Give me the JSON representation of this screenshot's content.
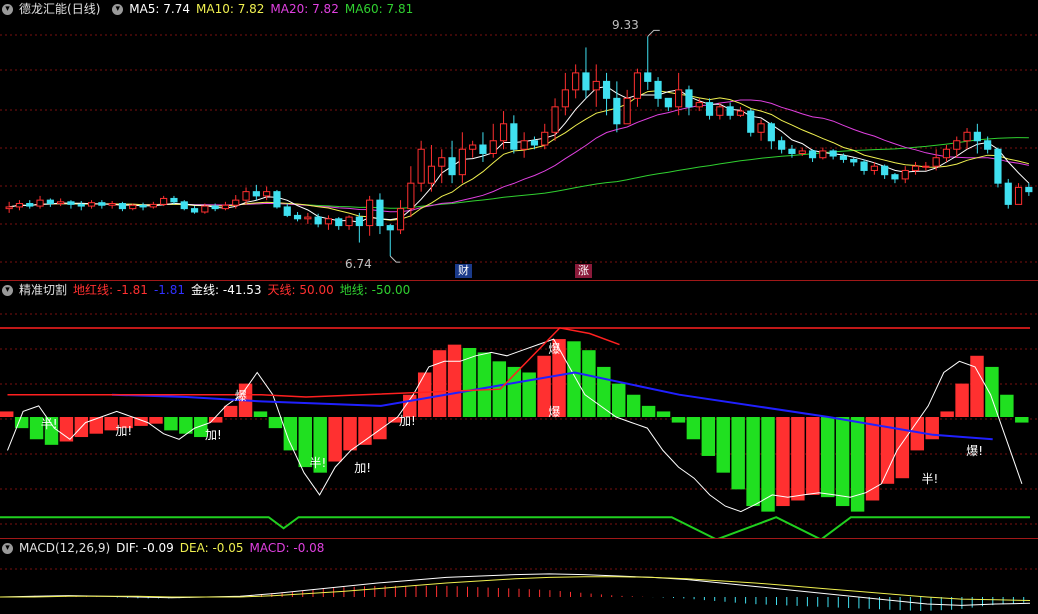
{
  "colors": {
    "ma5": "#ffffff",
    "ma10": "#f0f050",
    "ma20": "#e040e0",
    "ma60": "#30d030",
    "up": "#ff3030",
    "down": "#40e0f0",
    "grid": "#7a1010",
    "red_line": "#ff2020",
    "green_line": "#20d020",
    "blue_line": "#2020ff"
  },
  "main_pane": {
    "stock_name": "德龙汇能",
    "period": "(日线)",
    "ma5": "MA5: 7.74",
    "ma10": "MA10: 7.82",
    "ma20": "MA20: 7.82",
    "ma60": "MA60: 7.81",
    "high_label": "9.33",
    "low_label": "6.74",
    "badge_finance": "财",
    "badge_rise": "涨"
  },
  "indicator_pane": {
    "name": "精准切割",
    "dihong": "地红线: -1.81",
    "blue": "-1.81",
    "jin": "金线: -41.53",
    "tian": "天线: 50.00",
    "di": "地线: -50.00",
    "signals": [
      "半!",
      "加!",
      "加!",
      "爆",
      "半!",
      "加!",
      "加!",
      "爆",
      "爆",
      "爆!",
      "半!"
    ]
  },
  "macd_pane": {
    "name": "MACD(12,26,9)",
    "dif": "DIF: -0.09",
    "dea": "DEA: -0.05",
    "macd": "MACD: -0.08"
  },
  "series": {
    "candles": [
      [
        7.3,
        7.32,
        7.25,
        7.38
      ],
      [
        7.32,
        7.36,
        7.28,
        7.4
      ],
      [
        7.36,
        7.33,
        7.3,
        7.4
      ],
      [
        7.33,
        7.4,
        7.3,
        7.45
      ],
      [
        7.4,
        7.36,
        7.32,
        7.42
      ],
      [
        7.36,
        7.38,
        7.33,
        7.42
      ],
      [
        7.38,
        7.35,
        7.3,
        7.4
      ],
      [
        7.35,
        7.33,
        7.28,
        7.39
      ],
      [
        7.33,
        7.37,
        7.3,
        7.4
      ],
      [
        7.37,
        7.34,
        7.3,
        7.4
      ],
      [
        7.34,
        7.36,
        7.3,
        7.39
      ],
      [
        7.36,
        7.3,
        7.27,
        7.38
      ],
      [
        7.3,
        7.34,
        7.28,
        7.36
      ],
      [
        7.34,
        7.32,
        7.28,
        7.37
      ],
      [
        7.32,
        7.35,
        7.3,
        7.38
      ],
      [
        7.35,
        7.42,
        7.33,
        7.45
      ],
      [
        7.42,
        7.38,
        7.35,
        7.45
      ],
      [
        7.38,
        7.3,
        7.28,
        7.4
      ],
      [
        7.3,
        7.26,
        7.24,
        7.33
      ],
      [
        7.26,
        7.33,
        7.24,
        7.36
      ],
      [
        7.33,
        7.3,
        7.27,
        7.36
      ],
      [
        7.3,
        7.34,
        7.28,
        7.38
      ],
      [
        7.34,
        7.4,
        7.3,
        7.46
      ],
      [
        7.4,
        7.5,
        7.35,
        7.55
      ],
      [
        7.5,
        7.45,
        7.4,
        7.58
      ],
      [
        7.45,
        7.5,
        7.4,
        7.56
      ],
      [
        7.5,
        7.32,
        7.3,
        7.52
      ],
      [
        7.32,
        7.22,
        7.2,
        7.36
      ],
      [
        7.22,
        7.18,
        7.15,
        7.26
      ],
      [
        7.18,
        7.2,
        7.12,
        7.25
      ],
      [
        7.2,
        7.12,
        7.08,
        7.24
      ],
      [
        7.12,
        7.18,
        7.05,
        7.22
      ],
      [
        7.18,
        7.1,
        7.05,
        7.2
      ],
      [
        7.1,
        7.2,
        7.05,
        7.22
      ],
      [
        7.2,
        7.1,
        6.9,
        7.25
      ],
      [
        7.1,
        7.4,
        6.98,
        7.45
      ],
      [
        7.4,
        7.1,
        7.0,
        7.48
      ],
      [
        7.1,
        7.05,
        6.74,
        7.12
      ],
      [
        7.05,
        7.3,
        7.0,
        7.4
      ],
      [
        7.3,
        7.6,
        7.2,
        7.8
      ],
      [
        7.6,
        8.0,
        7.5,
        8.1
      ],
      [
        7.6,
        7.8,
        7.5,
        8.05
      ],
      [
        7.8,
        7.9,
        7.6,
        8.0
      ],
      [
        7.9,
        7.7,
        7.6,
        8.1
      ],
      [
        7.7,
        8.0,
        7.6,
        8.2
      ],
      [
        8.0,
        8.05,
        7.9,
        8.1
      ],
      [
        8.05,
        7.95,
        7.85,
        8.2
      ],
      [
        7.95,
        8.1,
        7.9,
        8.3
      ],
      [
        8.1,
        8.3,
        8.0,
        8.45
      ],
      [
        8.3,
        8.0,
        7.95,
        8.4
      ],
      [
        8.0,
        8.1,
        7.9,
        8.2
      ],
      [
        8.1,
        8.05,
        8.0,
        8.15
      ],
      [
        8.05,
        8.2,
        8.0,
        8.3
      ],
      [
        8.2,
        8.5,
        8.1,
        8.6
      ],
      [
        8.5,
        8.7,
        8.4,
        8.9
      ],
      [
        8.7,
        8.9,
        8.6,
        9.0
      ],
      [
        8.9,
        8.7,
        8.6,
        9.2
      ],
      [
        8.7,
        8.8,
        8.5,
        9.0
      ],
      [
        8.8,
        8.6,
        8.4,
        8.9
      ],
      [
        8.6,
        8.3,
        8.2,
        8.8
      ],
      [
        8.3,
        8.6,
        8.3,
        8.7
      ],
      [
        8.6,
        8.9,
        8.5,
        8.95
      ],
      [
        8.9,
        8.8,
        8.7,
        9.33
      ],
      [
        8.8,
        8.6,
        8.5,
        8.85
      ],
      [
        8.6,
        8.5,
        8.45,
        8.6
      ],
      [
        8.5,
        8.7,
        8.4,
        8.9
      ],
      [
        8.7,
        8.5,
        8.4,
        8.75
      ],
      [
        8.5,
        8.55,
        8.45,
        8.6
      ],
      [
        8.55,
        8.4,
        8.35,
        8.6
      ],
      [
        8.4,
        8.5,
        8.35,
        8.55
      ],
      [
        8.5,
        8.4,
        8.35,
        8.55
      ],
      [
        8.4,
        8.45,
        8.38,
        8.5
      ],
      [
        8.45,
        8.2,
        8.15,
        8.48
      ],
      [
        8.2,
        8.3,
        8.1,
        8.35
      ],
      [
        8.3,
        8.1,
        8.0,
        8.32
      ],
      [
        8.1,
        8.0,
        7.95,
        8.15
      ],
      [
        8.0,
        7.95,
        7.9,
        8.05
      ],
      [
        7.95,
        7.98,
        7.92,
        8.02
      ],
      [
        7.98,
        7.9,
        7.85,
        8.0
      ],
      [
        7.9,
        7.98,
        7.88,
        8.02
      ],
      [
        7.98,
        7.92,
        7.88,
        8.0
      ],
      [
        7.92,
        7.88,
        7.84,
        7.95
      ],
      [
        7.88,
        7.85,
        7.8,
        7.9
      ],
      [
        7.85,
        7.75,
        7.7,
        7.88
      ],
      [
        7.75,
        7.8,
        7.7,
        7.85
      ],
      [
        7.8,
        7.7,
        7.65,
        7.82
      ],
      [
        7.7,
        7.65,
        7.6,
        7.72
      ],
      [
        7.65,
        7.75,
        7.6,
        7.8
      ],
      [
        7.75,
        7.8,
        7.7,
        7.85
      ],
      [
        7.8,
        7.8,
        7.75,
        7.85
      ],
      [
        7.8,
        7.9,
        7.75,
        8.0
      ],
      [
        7.9,
        8.0,
        7.85,
        8.05
      ],
      [
        8.0,
        8.1,
        7.9,
        8.15
      ],
      [
        8.1,
        8.2,
        8.0,
        8.25
      ],
      [
        8.2,
        8.1,
        7.95,
        8.3
      ],
      [
        8.1,
        8.0,
        7.95,
        8.15
      ],
      [
        8.0,
        7.6,
        7.55,
        8.02
      ],
      [
        7.6,
        7.35,
        7.3,
        7.65
      ],
      [
        7.35,
        7.55,
        7.35,
        7.6
      ],
      [
        7.55,
        7.5,
        7.45,
        7.6
      ]
    ],
    "ind_bars": [
      5,
      -10,
      -20,
      -25,
      -22,
      -18,
      -15,
      -12,
      -10,
      -8,
      -6,
      -12,
      -15,
      -18,
      -5,
      10,
      30,
      5,
      -10,
      -30,
      -45,
      -50,
      -40,
      -30,
      -25,
      -20,
      -5,
      20,
      40,
      60,
      65,
      62,
      58,
      50,
      45,
      40,
      55,
      70,
      68,
      60,
      45,
      30,
      20,
      10,
      5,
      -5,
      -20,
      -35,
      -50,
      -65,
      -80,
      -85,
      -80,
      -75,
      -70,
      -72,
      -80,
      -85,
      -75,
      -60,
      -55,
      -30,
      -20,
      5,
      30,
      55,
      45,
      20,
      -5
    ],
    "ind_white": [
      -30,
      5,
      10,
      -10,
      -20,
      -5,
      0,
      5,
      0,
      -5,
      -15,
      -20,
      -10,
      -5,
      10,
      20,
      40,
      20,
      -20,
      -50,
      -70,
      -45,
      -30,
      -20,
      -10,
      0,
      20,
      45,
      50,
      50,
      55,
      58,
      55,
      60,
      65,
      70,
      45,
      20,
      10,
      0,
      -5,
      -10,
      -30,
      -45,
      -55,
      -70,
      -80,
      -85,
      -78,
      -70,
      -72,
      -70,
      -68,
      -70,
      -72,
      -68,
      -60,
      -30,
      -10,
      10,
      40,
      50,
      45,
      20,
      -20,
      -60
    ],
    "ind_red": [
      [
        0,
        0
      ],
      [
        17,
        0
      ],
      [
        20,
        -2
      ],
      [
        33,
        5
      ],
      [
        37,
        60
      ],
      [
        39,
        55
      ],
      [
        41,
        45
      ]
    ],
    "ind_blue": [
      [
        7,
        0
      ],
      [
        12,
        -1
      ],
      [
        17,
        -3
      ],
      [
        25,
        -5
      ],
      [
        38,
        10
      ],
      [
        45,
        0
      ],
      [
        55,
        -10
      ],
      [
        62,
        -18
      ],
      [
        66,
        -20
      ]
    ],
    "ind_green": [
      [
        0,
        -50
      ],
      [
        18,
        -50
      ],
      [
        19,
        -55
      ],
      [
        20,
        -50
      ],
      [
        45,
        -50
      ],
      [
        48,
        -60
      ],
      [
        52,
        -50
      ],
      [
        55,
        -60
      ],
      [
        57,
        -50
      ],
      [
        69,
        -50
      ]
    ],
    "macd_dif": [
      0,
      0.01,
      0.02,
      0.01,
      0.0,
      -0.01,
      0.0,
      0.01,
      0.05,
      0.1,
      0.15,
      0.2,
      0.24,
      0.28,
      0.3,
      0.32,
      0.33,
      0.32,
      0.3,
      0.28,
      0.25,
      0.2,
      0.15,
      0.1,
      0.05,
      0.0,
      -0.05,
      -0.1,
      -0.12,
      -0.1,
      -0.09
    ],
    "macd_dea": [
      0,
      0.0,
      0.01,
      0.01,
      0.01,
      0.0,
      0.0,
      0.0,
      0.02,
      0.05,
      0.08,
      0.12,
      0.16,
      0.2,
      0.23,
      0.26,
      0.28,
      0.29,
      0.29,
      0.28,
      0.26,
      0.23,
      0.2,
      0.16,
      0.12,
      0.08,
      0.04,
      0.0,
      -0.03,
      -0.04,
      -0.05
    ]
  }
}
